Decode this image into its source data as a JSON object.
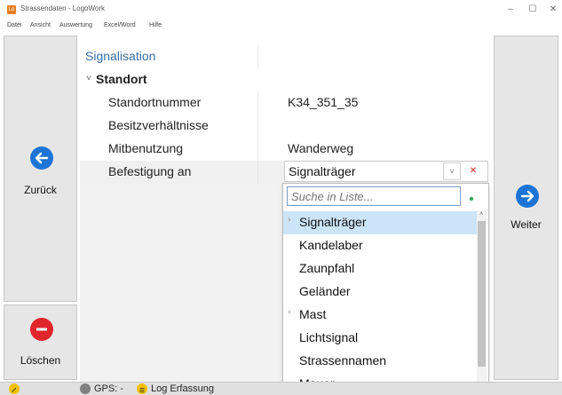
{
  "window": {
    "title": "Strassendaten - LogoWork",
    "app_icon": "Lo",
    "minimize": "–",
    "maximize": "☐",
    "close": "✕"
  },
  "menu": [
    "Datei",
    "Ansicht",
    "Auswertung",
    "Excel/Word",
    "Hilfe"
  ],
  "nav": {
    "back_label": "Zurück",
    "next_label": "Weiter",
    "delete_label": "Löschen"
  },
  "grid": {
    "section": "Signalisation",
    "group": "Standort",
    "rows": [
      {
        "name": "Standortnummer",
        "value": "K34_351_35"
      },
      {
        "name": "Besitzverhältnisse",
        "value": ""
      },
      {
        "name": "Mitbenutzung",
        "value": "Wanderweg"
      },
      {
        "name": "Befestigung an",
        "value": "Signalträger"
      }
    ]
  },
  "dropdown": {
    "search_placeholder": "Suche in Liste...",
    "items": [
      {
        "label": "Signalträger",
        "has_children": true,
        "selected": true
      },
      {
        "label": "Kandelaber",
        "has_children": false
      },
      {
        "label": "Zaunpfahl",
        "has_children": false
      },
      {
        "label": "Geländer",
        "has_children": false
      },
      {
        "label": "Mast",
        "has_children": true
      },
      {
        "label": "Lichtsignal",
        "has_children": false
      },
      {
        "label": "Strassennamen",
        "has_children": false
      },
      {
        "label": "Mauer",
        "has_children": false
      }
    ]
  },
  "status": {
    "gps": "GPS: -",
    "log": "Log Erfassung"
  },
  "colors": {
    "accent": "#1e74d6",
    "danger": "#e0262b",
    "selection": "#cce4f7",
    "log_icon": "#f2c200",
    "edit_icon": "#f2c200"
  }
}
